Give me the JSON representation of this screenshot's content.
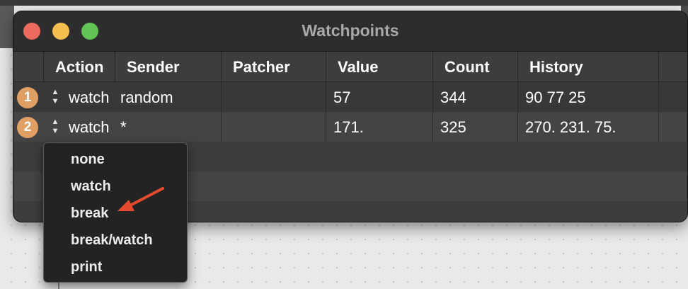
{
  "window": {
    "title": "Watchpoints"
  },
  "columns": [
    "Action",
    "Sender",
    "Patcher",
    "Value",
    "Count",
    "History"
  ],
  "rows": [
    {
      "index": "1",
      "action": "watch",
      "sender": "random",
      "patcher": "",
      "value": "57",
      "count": "344",
      "history": "90 77 25"
    },
    {
      "index": "2",
      "action": "watch",
      "sender": "*",
      "patcher": "",
      "value": "171.",
      "count": "325",
      "history": "270. 231. 75."
    }
  ],
  "action_menu": {
    "options": [
      "none",
      "watch",
      "break",
      "break/watch",
      "print"
    ]
  },
  "colors": {
    "badge": "#e0a064",
    "annotation_arrow": "#e64a2e",
    "close": "#ed6a5e",
    "minimize": "#f5bf4f",
    "zoom": "#61c454"
  },
  "icons": {
    "row_control": "up-down-arrows-icon",
    "annotation": "red-arrow-icon"
  }
}
